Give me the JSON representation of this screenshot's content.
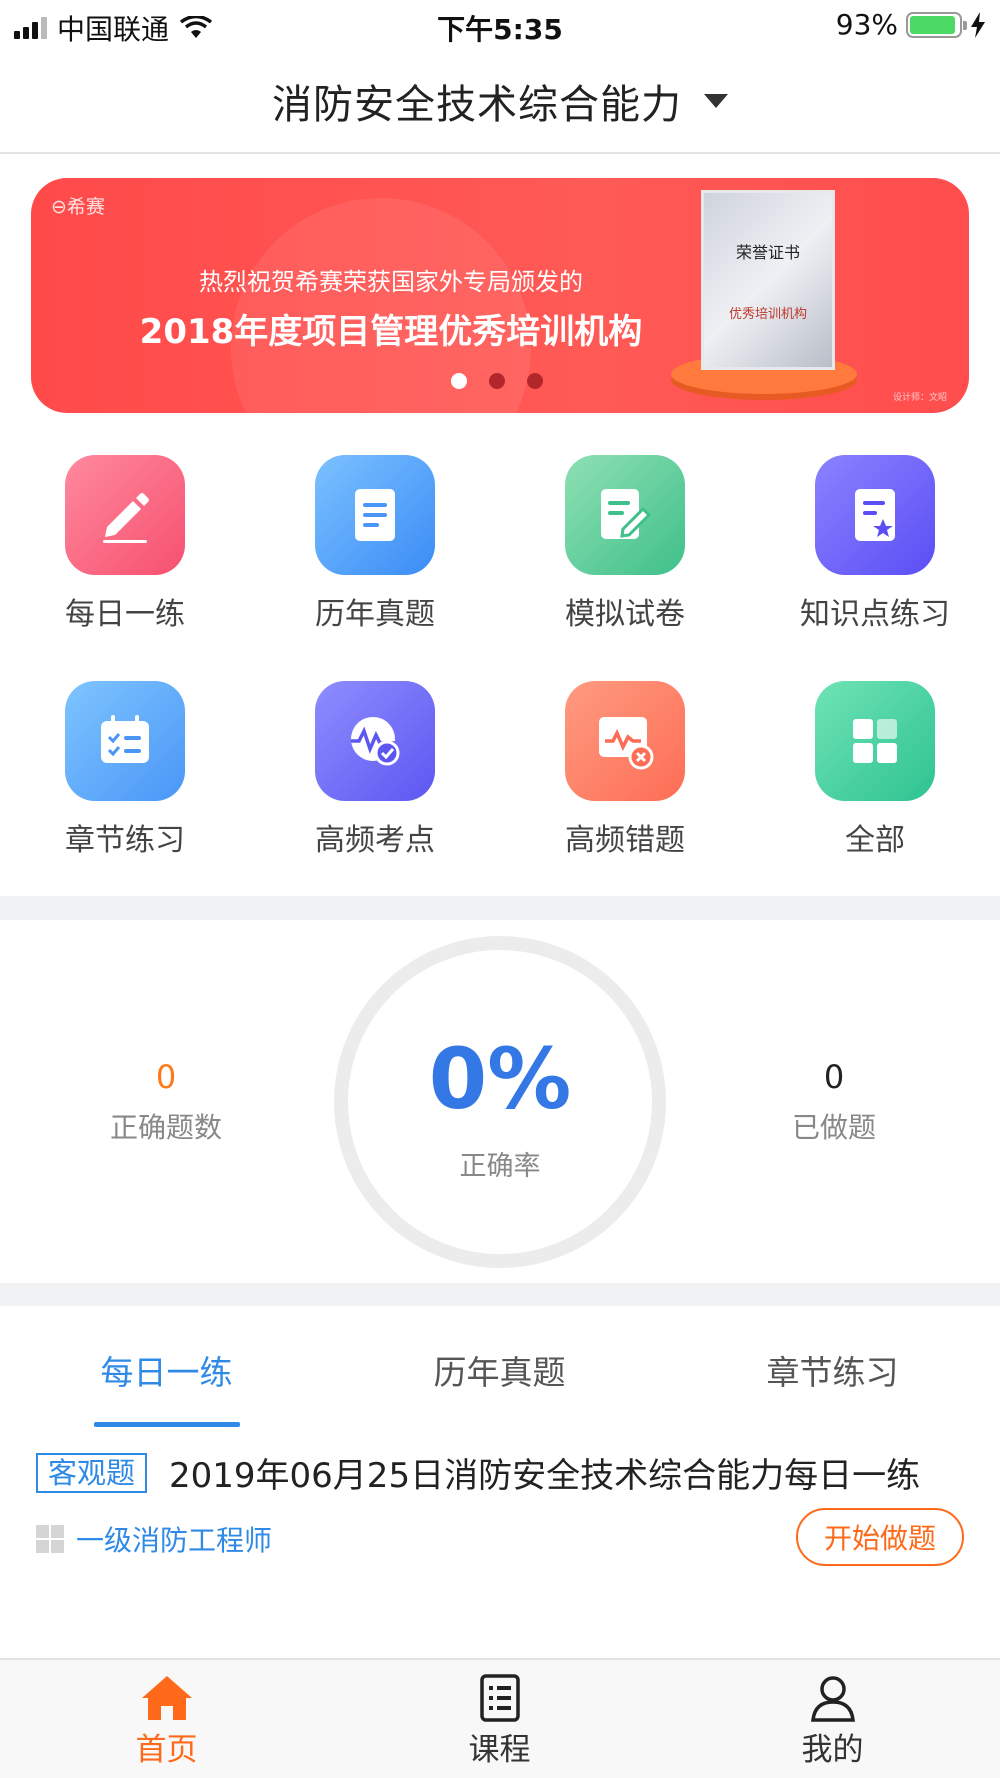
{
  "status_bar": {
    "carrier": "中国联通",
    "time": "下午5:35",
    "battery": "93%",
    "battery_level": 0.93
  },
  "header": {
    "title": "消防安全技术综合能力",
    "dropdown_icon": "caret-down-icon"
  },
  "banner": {
    "logo_text": "希赛",
    "line1": "热烈祝贺希赛荣获国家外专局颁发的",
    "line2": "2018年度项目管理优秀培训机构",
    "certificate_title": "荣誉证书",
    "certificate_subtitle": "优秀培训机构",
    "designer": "设计师：文昭",
    "slides": 3,
    "active_slide": 1
  },
  "quick_menu": [
    {
      "label": "每日一练",
      "icon": "pencil-icon"
    },
    {
      "label": "历年真题",
      "icon": "document-icon"
    },
    {
      "label": "模拟试卷",
      "icon": "edit-paper-icon"
    },
    {
      "label": "知识点练习",
      "icon": "star-document-icon"
    },
    {
      "label": "章节练习",
      "icon": "checklist-icon"
    },
    {
      "label": "高频考点",
      "icon": "wave-check-icon"
    },
    {
      "label": "高频错题",
      "icon": "chart-error-icon"
    },
    {
      "label": "全部",
      "icon": "grid-icon"
    }
  ],
  "stats": {
    "correct_count": "0",
    "correct_label": "正确题数",
    "accuracy": "0%",
    "accuracy_label": "正确率",
    "done_count": "0",
    "done_label": "已做题"
  },
  "tabs": [
    {
      "label": "每日一练",
      "active": true
    },
    {
      "label": "历年真题",
      "active": false
    },
    {
      "label": "章节练习",
      "active": false
    }
  ],
  "question": {
    "tag": "客观题",
    "title": "2019年06月25日消防安全技术综合能力每日一练",
    "category": "一级消防工程师",
    "start_label": "开始做题"
  },
  "bottom_nav": [
    {
      "label": "首页",
      "icon": "home-icon",
      "active": true
    },
    {
      "label": "课程",
      "icon": "list-document-icon",
      "active": false
    },
    {
      "label": "我的",
      "icon": "user-icon",
      "active": false
    }
  ],
  "colors": {
    "accent_blue": "#2f8ae6",
    "accent_orange": "#ff6a1a",
    "banner_red": "#ff4a4a"
  }
}
